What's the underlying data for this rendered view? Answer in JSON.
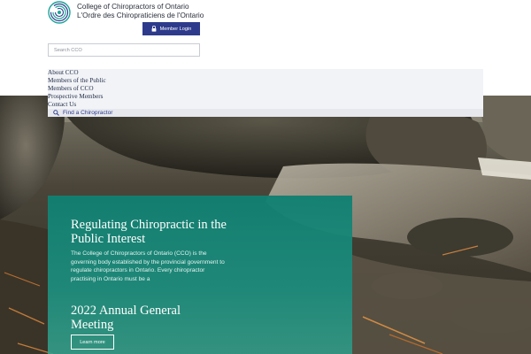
{
  "header": {
    "org_name_en": "College of Chiropractors of Ontario",
    "org_name_fr": "L'Ordre des Chiropraticiens de l'Ontario",
    "member_login_label": "Member Login",
    "search_placeholder": "Search CCO"
  },
  "nav": {
    "items": [
      {
        "label": "About CCO"
      },
      {
        "label": "Members of the Public"
      },
      {
        "label": "Members of CCO"
      },
      {
        "label": "Prospective Members"
      },
      {
        "label": "Contact Us"
      }
    ],
    "find_label": "Find a Chiropractor"
  },
  "hero": {
    "title": "Regulating Chiropractic in the Public Interest",
    "body": "The College of Chiropractors of Ontario (CCO) is the governing body established by the provincial government to regulate chiropractors in Ontario. Every chiropractor practising in Ontario must be a",
    "agm_title": "2022 Annual General Meeting",
    "learn_more_label": "Learn more"
  },
  "colors": {
    "brand_blue": "#2e3b8c",
    "teal": "#108072",
    "logo_teal": "#1fa39a"
  },
  "icons": {
    "lock": "lock-icon",
    "search": "search-icon",
    "logo": "cco-logo-icon"
  }
}
